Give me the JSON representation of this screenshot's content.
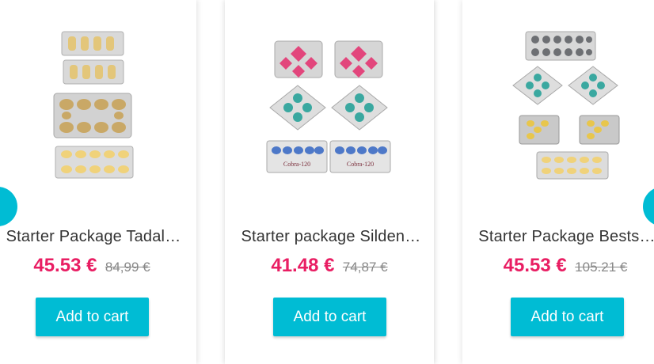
{
  "carousel": {
    "prev_label": "",
    "next_label": "",
    "accent_color": "#00bcd4",
    "price_color": "#e91e63",
    "products": [
      {
        "name": "Starter Package Tadal…",
        "price": "45.53 €",
        "old_price": "84,99 €",
        "add_to_cart": "Add to cart",
        "image_icon": "tadalafil-blister-packs-image"
      },
      {
        "name": "Starter package Silden…",
        "price": "41.48 €",
        "old_price": "74,87 €",
        "add_to_cart": "Add to cart",
        "image_icon": "sildenafil-blister-packs-image",
        "image_text": [
          "Cobra-120",
          "Cobra-120"
        ]
      },
      {
        "name": "Starter Package Bests…",
        "price": "45.53 €",
        "old_price": "105.21 €",
        "add_to_cart": "Add to cart",
        "image_icon": "bestseller-blister-packs-image"
      }
    ]
  }
}
